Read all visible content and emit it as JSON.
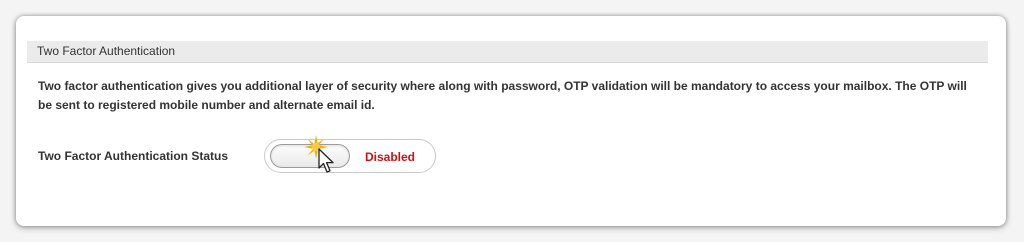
{
  "section": {
    "title": "Two Factor Authentication",
    "description": "Two factor authentication gives you additional layer of security where along with password, OTP validation will be mandatory to access your mailbox. The OTP will be sent to registered mobile number and alternate email id."
  },
  "status": {
    "label": "Two Factor Authentication Status",
    "toggle": {
      "state": "off",
      "text": "Disabled",
      "text_color": "#cc1111"
    }
  },
  "overlay": {
    "cursor_icon": "arrow-cursor-icon",
    "click_indicator_icon": "click-burst-icon",
    "click_indicator_color": "#f0b400"
  }
}
